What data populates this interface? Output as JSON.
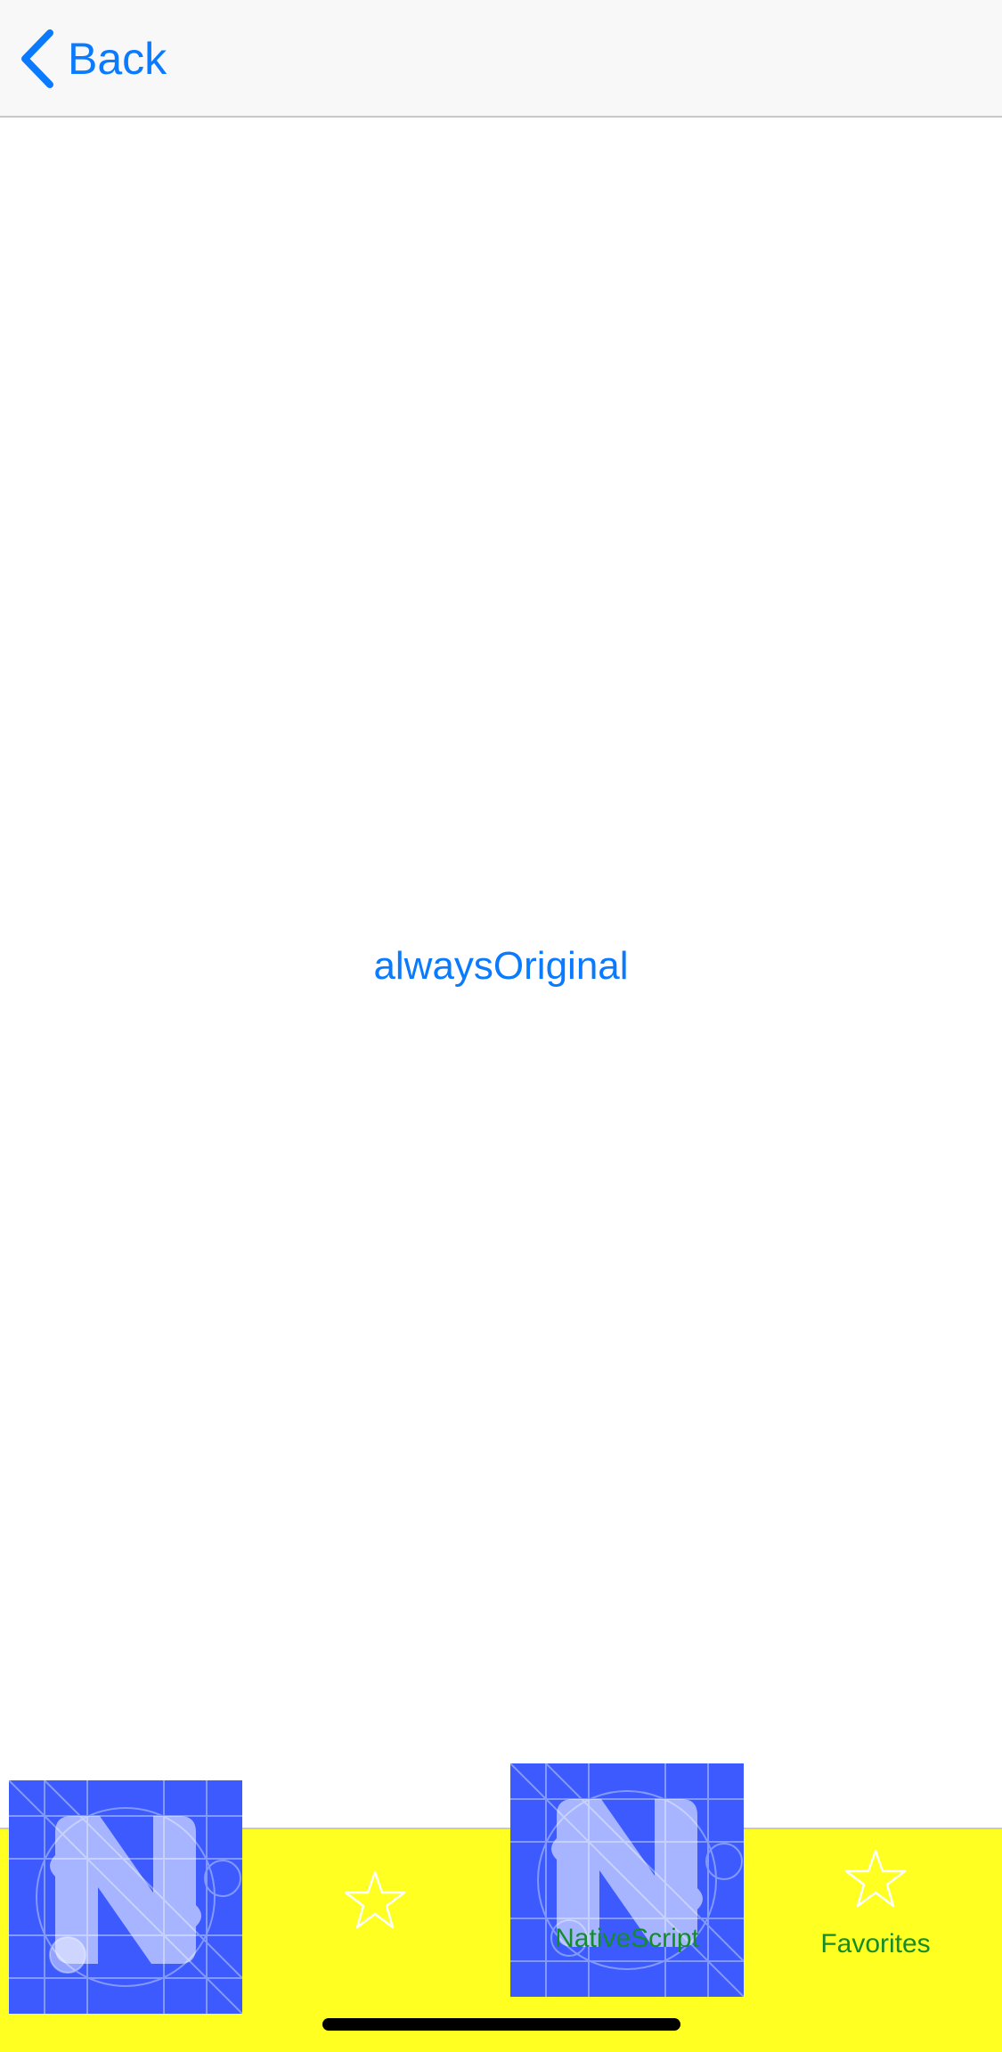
{
  "nav": {
    "back_label": "Back"
  },
  "main": {
    "center_text": "alwaysOriginal"
  },
  "tabs": [
    {
      "label": "",
      "icon": "nativescript-logo-icon"
    },
    {
      "label": "",
      "icon": "star-icon"
    },
    {
      "label": "NativeScript",
      "icon": "nativescript-logo-icon"
    },
    {
      "label": "Favorites",
      "icon": "star-icon"
    }
  ],
  "colors": {
    "accent": "#0a7aff",
    "tab_bar_background": "#ffff22",
    "tab_label": "#148c2a",
    "logo_background": "#3d5afe"
  }
}
